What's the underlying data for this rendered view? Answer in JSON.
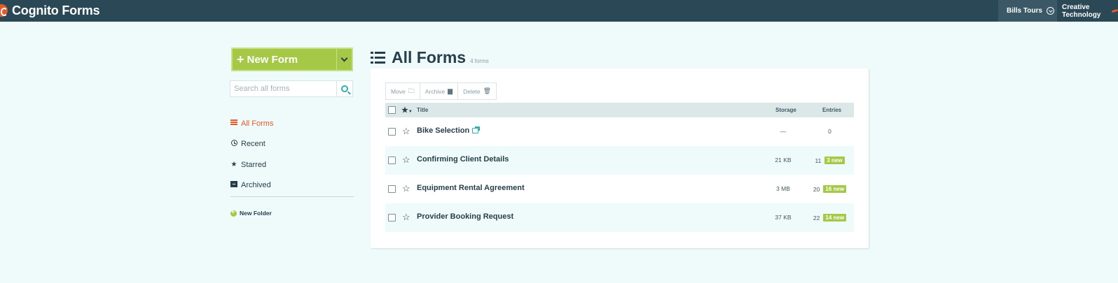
{
  "topbar": {
    "brand": "Cognito Forms",
    "org_current": "Bills Tours",
    "org_other": "Creative Technology"
  },
  "sidebar": {
    "new_form_label": "New Form",
    "search_placeholder": "Search all forms",
    "nav": [
      {
        "label": "All Forms",
        "icon": "list-icon",
        "active": true
      },
      {
        "label": "Recent",
        "icon": "clock-icon",
        "active": false
      },
      {
        "label": "Starred",
        "icon": "star-icon",
        "active": false
      },
      {
        "label": "Archived",
        "icon": "archive-icon",
        "active": false
      }
    ],
    "new_folder_label": "New Folder"
  },
  "main": {
    "title": "All Forms",
    "count": "4 forms",
    "toolbar": {
      "move": "Move",
      "archive": "Archive",
      "delete": "Delete"
    },
    "columns": {
      "title": "Title",
      "storage": "Storage",
      "entries": "Entries"
    },
    "rows": [
      {
        "title": "Bike Selection",
        "storage": "—",
        "entries": "0",
        "new": "",
        "public_link": true
      },
      {
        "title": "Confirming Client Details",
        "storage": "21 KB",
        "entries": "11",
        "new": "3 new",
        "public_link": false
      },
      {
        "title": "Equipment Rental Agreement",
        "storage": "3 MB",
        "entries": "20",
        "new": "16 new",
        "public_link": false
      },
      {
        "title": "Provider Booking Request",
        "storage": "37 KB",
        "entries": "22",
        "new": "14 new",
        "public_link": false
      }
    ]
  },
  "colors": {
    "topbar": "#2a4856",
    "accent_green": "#a5c946",
    "accent_orange": "#e55a2b",
    "accent_teal": "#2db0ac",
    "background": "#effafa"
  }
}
